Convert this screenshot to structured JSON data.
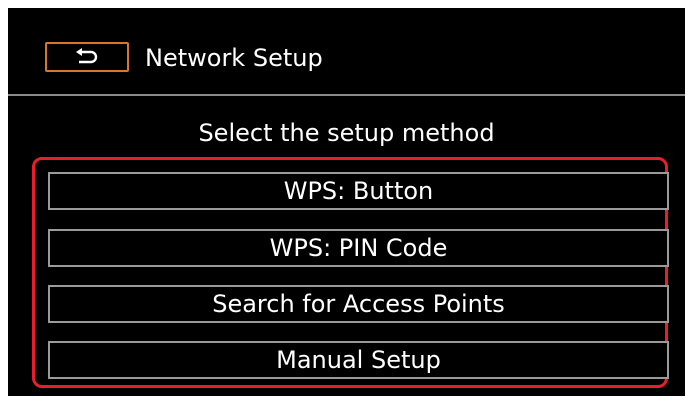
{
  "header": {
    "back_icon": "return-arrow-icon",
    "title": "Network Setup"
  },
  "prompt": "Select the setup method",
  "options": [
    {
      "label": "WPS: Button"
    },
    {
      "label": "WPS: PIN Code"
    },
    {
      "label": "Search for Access Points"
    },
    {
      "label": "Manual Setup"
    }
  ],
  "colors": {
    "background": "#000000",
    "text": "#ffffff",
    "back_button_border": "#d6772c",
    "highlight_frame": "#e5202a",
    "option_border": "#9a9a9a"
  }
}
